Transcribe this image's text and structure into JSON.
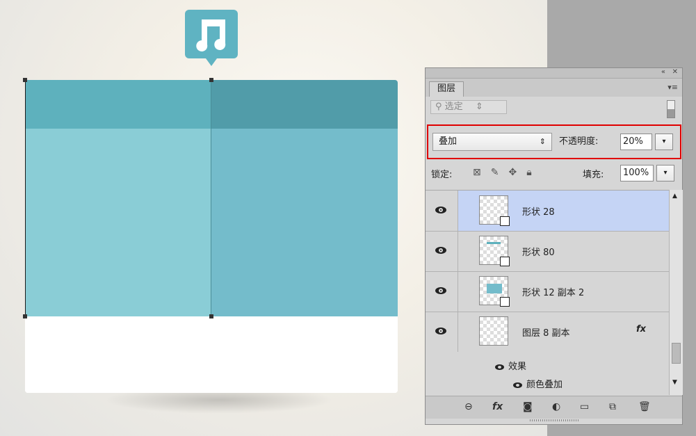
{
  "panel": {
    "tab_label": "图层",
    "filter": {
      "placeholder": "选定"
    },
    "blend_mode": "叠加",
    "opacity_label": "不透明度:",
    "opacity_value": "20%",
    "lock_label": "锁定:",
    "fill_label": "填充:",
    "fill_value": "100%",
    "layers": [
      {
        "name": "形状 28",
        "visible": true,
        "selected": true
      },
      {
        "name": "形状 80",
        "visible": true,
        "selected": false
      },
      {
        "name": "形状 12 副本 2",
        "visible": true,
        "selected": false
      },
      {
        "name": "图层 8 副本",
        "visible": true,
        "selected": false,
        "fx": "fx"
      }
    ],
    "effects_label": "效果",
    "effect_item": "颜色叠加"
  },
  "colors": {
    "highlight_border": "#e00000",
    "selected_row": "#c5d4f5",
    "teal_dark": "#519ca9",
    "teal_light": "#8acdd6"
  },
  "icons": [
    "music-note-icon",
    "link-icon",
    "fx-icon",
    "mask-icon",
    "adjustment-icon",
    "folder-icon",
    "new-layer-icon",
    "trash-icon",
    "eye-icon",
    "lock-icon",
    "brush-icon",
    "move-icon",
    "search-icon"
  ]
}
